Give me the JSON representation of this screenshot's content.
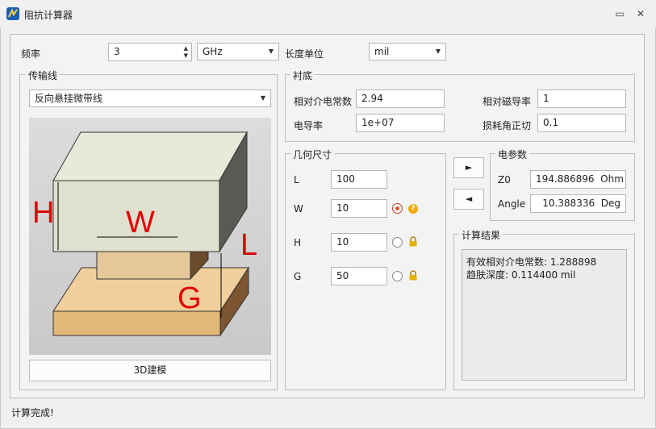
{
  "window": {
    "title": "阻抗计算器"
  },
  "frequency": {
    "label": "频率",
    "value": "3",
    "unit": "GHz"
  },
  "length_unit": {
    "label": "长度单位",
    "value": "mil"
  },
  "transmission_line": {
    "title": "传输线",
    "type": "反向悬挂微带线",
    "model_button": "3D建模",
    "diagram": {
      "h": "H",
      "w": "W",
      "l": "L",
      "g": "G"
    }
  },
  "substrate": {
    "title": "衬底",
    "relative_permittivity": {
      "label": "相对介电常数",
      "value": "2.94"
    },
    "relative_permeability": {
      "label": "相对磁导率",
      "value": "1"
    },
    "conductivity": {
      "label": "电导率",
      "value": "1e+07"
    },
    "loss_tangent": {
      "label": "损耗角正切",
      "value": "0.1"
    }
  },
  "geometry": {
    "title": "几何尺寸",
    "L": {
      "label": "L",
      "value": "100"
    },
    "W": {
      "label": "W",
      "value": "10"
    },
    "H": {
      "label": "H",
      "value": "10"
    },
    "G": {
      "label": "G",
      "value": "50"
    }
  },
  "arrows": {
    "forward": "►",
    "backward": "◄"
  },
  "electrical": {
    "title": "电参数",
    "z0": {
      "label": "Z0",
      "value": "194.886896",
      "unit": "Ohm"
    },
    "angle": {
      "label": "Angle",
      "value": "10.388336",
      "unit": "Deg"
    }
  },
  "results": {
    "title": "计算结果",
    "lines": [
      "有效相对介电常数: 1.288898",
      "趋肤深度: 0.114400 mil"
    ]
  },
  "status": "计算完成!",
  "icons": {
    "minimize": "▭",
    "close": "✕"
  }
}
